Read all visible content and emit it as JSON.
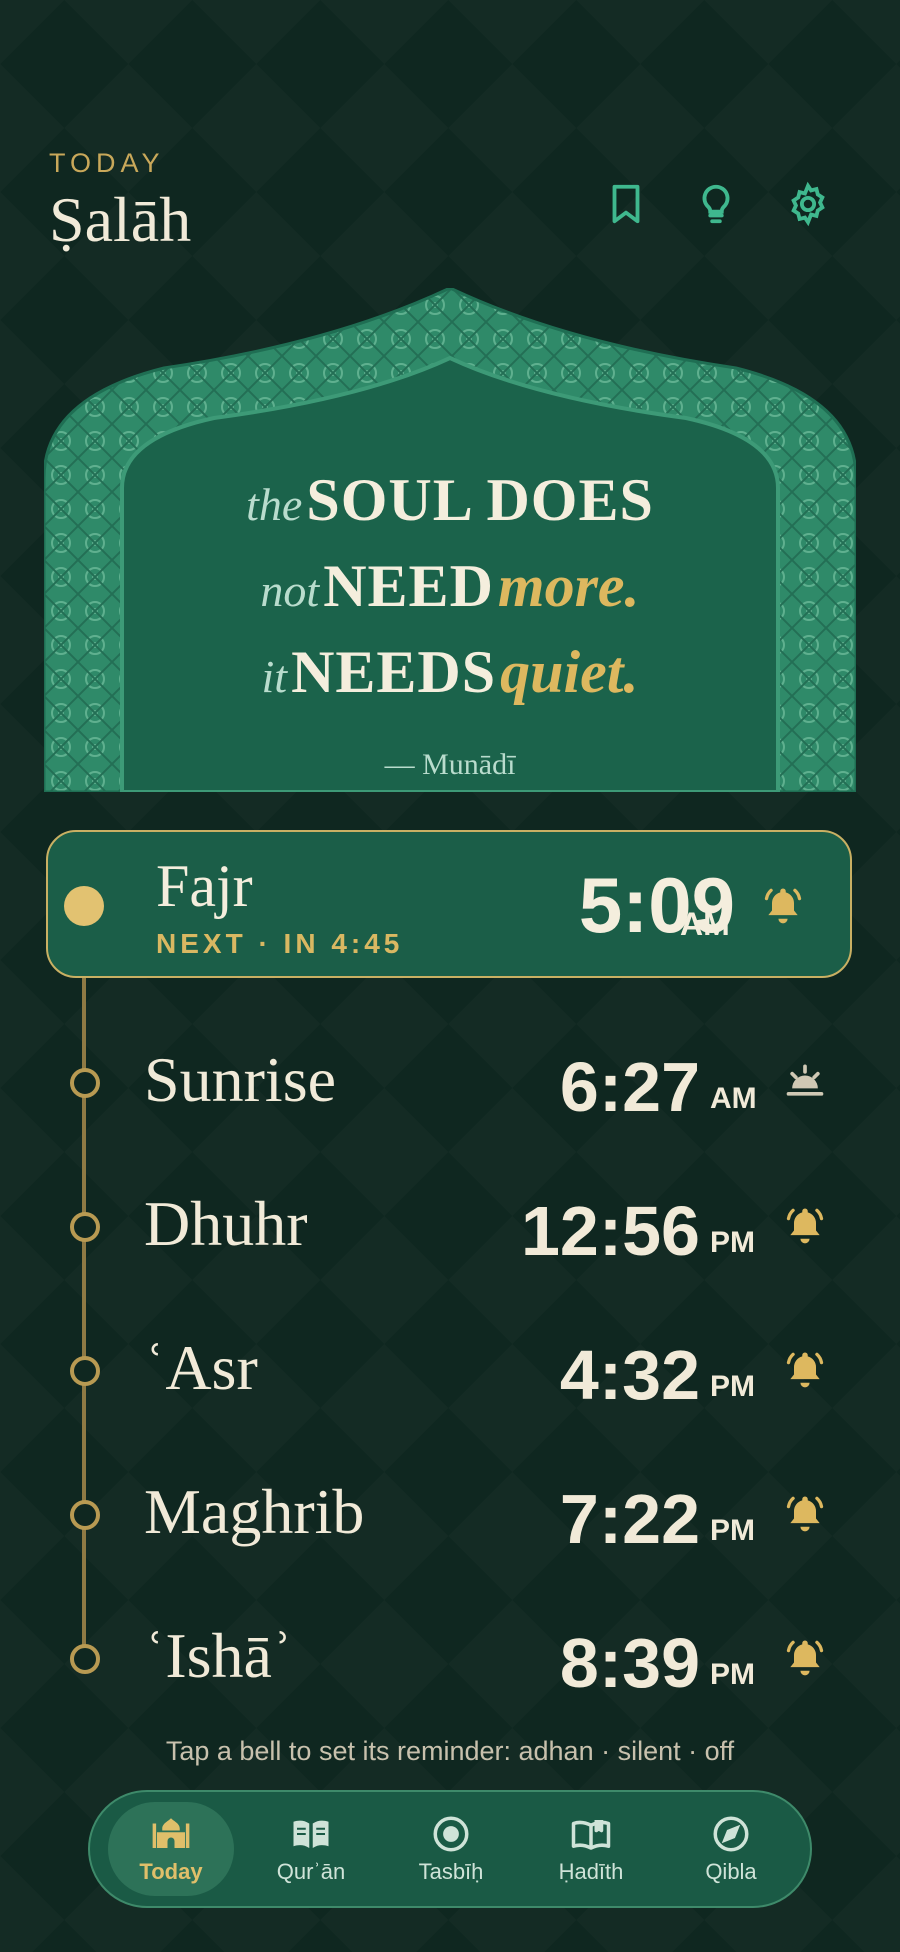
{
  "header": {
    "eyebrow": "TODAY",
    "title": "Ṣalāh",
    "actions": [
      "bookmark-icon",
      "lightbulb-icon",
      "gear-icon"
    ]
  },
  "quote": {
    "line1_italic": "the",
    "line1_caps": "SOUL DOES",
    "line2_italic": "not",
    "line2_caps": "NEED",
    "line2_gold": "more.",
    "line3_italic": "it",
    "line3_caps": "NEEDS",
    "line3_gold": "quiet.",
    "author": "— Munādī"
  },
  "next_prayer": {
    "name": "Fajr",
    "subtitle": "NEXT · IN 4:45",
    "time": "5:09",
    "ampm": "AM",
    "icon": "bell-icon"
  },
  "prayers": [
    {
      "name": "Sunrise",
      "time": "6:27",
      "ampm": "AM",
      "icon": "sunrise-icon"
    },
    {
      "name": "Dhuhr",
      "time": "12:56",
      "ampm": "PM",
      "icon": "bell-icon"
    },
    {
      "name": "ʿAsr",
      "time": "4:32",
      "ampm": "PM",
      "icon": "bell-icon"
    },
    {
      "name": "Maghrib",
      "time": "7:22",
      "ampm": "PM",
      "icon": "bell-icon"
    },
    {
      "name": "ʿIshāʾ",
      "time": "8:39",
      "ampm": "PM",
      "icon": "bell-icon"
    }
  ],
  "hint": "Tap a bell to set its reminder: adhan · silent · off",
  "nav": {
    "items": [
      {
        "label": "Today",
        "icon": "mosque-icon",
        "active": true
      },
      {
        "label": "Qurʾān",
        "icon": "open-book-icon",
        "active": false
      },
      {
        "label": "Tasbīḥ",
        "icon": "target-icon",
        "active": false
      },
      {
        "label": "Ḥadīth",
        "icon": "book-icon",
        "active": false
      },
      {
        "label": "Qibla",
        "icon": "compass-icon",
        "active": false
      }
    ]
  },
  "colors": {
    "background": "#0f2720",
    "card": "#1b5e48",
    "gold": "#d9b862",
    "accent_teal": "#3fb88e",
    "text": "#f1ead8"
  }
}
